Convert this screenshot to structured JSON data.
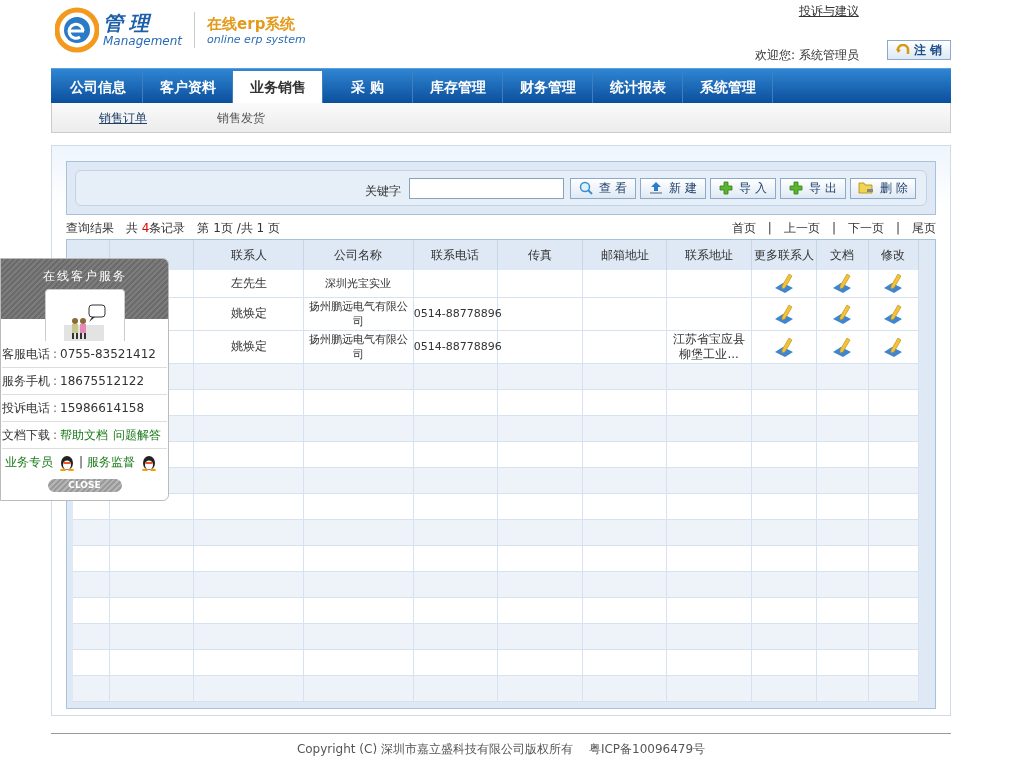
{
  "header": {
    "logo": {
      "mark": "管理",
      "brand": "Management",
      "product": "在线erp系统",
      "tagline": "online erp system"
    },
    "feedback_link": "投诉与建议",
    "welcome": "欢迎您: 系统管理员",
    "logout_button": "注 销"
  },
  "nav": {
    "tabs": [
      {
        "label": "公司信息",
        "selected": false
      },
      {
        "label": "客户资料",
        "selected": false
      },
      {
        "label": "业务销售",
        "selected": true
      },
      {
        "label": "采 购",
        "selected": false
      },
      {
        "label": "库存管理",
        "selected": false
      },
      {
        "label": "财务管理",
        "selected": false
      },
      {
        "label": "统计报表",
        "selected": false
      },
      {
        "label": "系统管理",
        "selected": false
      }
    ],
    "subtabs": [
      {
        "label": "销售订单",
        "selected": true
      },
      {
        "label": "销售发货",
        "selected": false
      }
    ]
  },
  "search": {
    "label": "关键字",
    "buttons": [
      {
        "label": "查 看",
        "kind": "search"
      },
      {
        "label": "新 建",
        "kind": "upload"
      },
      {
        "label": "导 入",
        "kind": "plus"
      },
      {
        "label": "导 出",
        "kind": "plus"
      },
      {
        "label": "删 除",
        "kind": "folder"
      }
    ]
  },
  "results": {
    "title": "查询结果",
    "total_prefix": "共",
    "total": "4",
    "total_suffix": "条记录",
    "page_info": "第 1页 /共 1 页",
    "pager": [
      "首页",
      "上一页",
      "下一页",
      "尾页"
    ],
    "pager_separator": "|"
  },
  "table": {
    "columns": [
      "联系人",
      "公司名称",
      "联系电话",
      "传真",
      "邮箱地址",
      "联系地址",
      "更多联系人",
      "文档",
      "修改"
    ],
    "rows": [
      {
        "contact": "左先生",
        "company": "深圳光宝实业"
      },
      {
        "contact": "姚焕定",
        "company": "扬州鹏远电气有限公司",
        "phone": "0514-88778896"
      },
      {
        "contact": "姚焕定",
        "company": "扬州鹏远电气有限公司",
        "phone": "0514-88778896",
        "address": "江苏省宝应县柳堡工业..."
      }
    ]
  },
  "service_popup": {
    "title": "在线客户服务",
    "lines": [
      {
        "kind": "text",
        "label": "客服电话",
        "value": "0755-83521412"
      },
      {
        "kind": "text",
        "label": "服务手机",
        "value": "18675512122"
      },
      {
        "kind": "text",
        "label": "投诉电话",
        "value": "15986614158"
      },
      {
        "kind": "links",
        "label": "文档下载",
        "links": [
          "帮助文档",
          "问题解答"
        ]
      }
    ],
    "label_separator": ":",
    "contacts": [
      "业务专员",
      "服务监督"
    ],
    "contact_separator": "|",
    "close": "CLOSE"
  },
  "footer": {
    "copyright": "Copyright (C) 深圳市嘉立盛科技有限公司版权所有",
    "icp": "粤ICP备10096479号"
  }
}
